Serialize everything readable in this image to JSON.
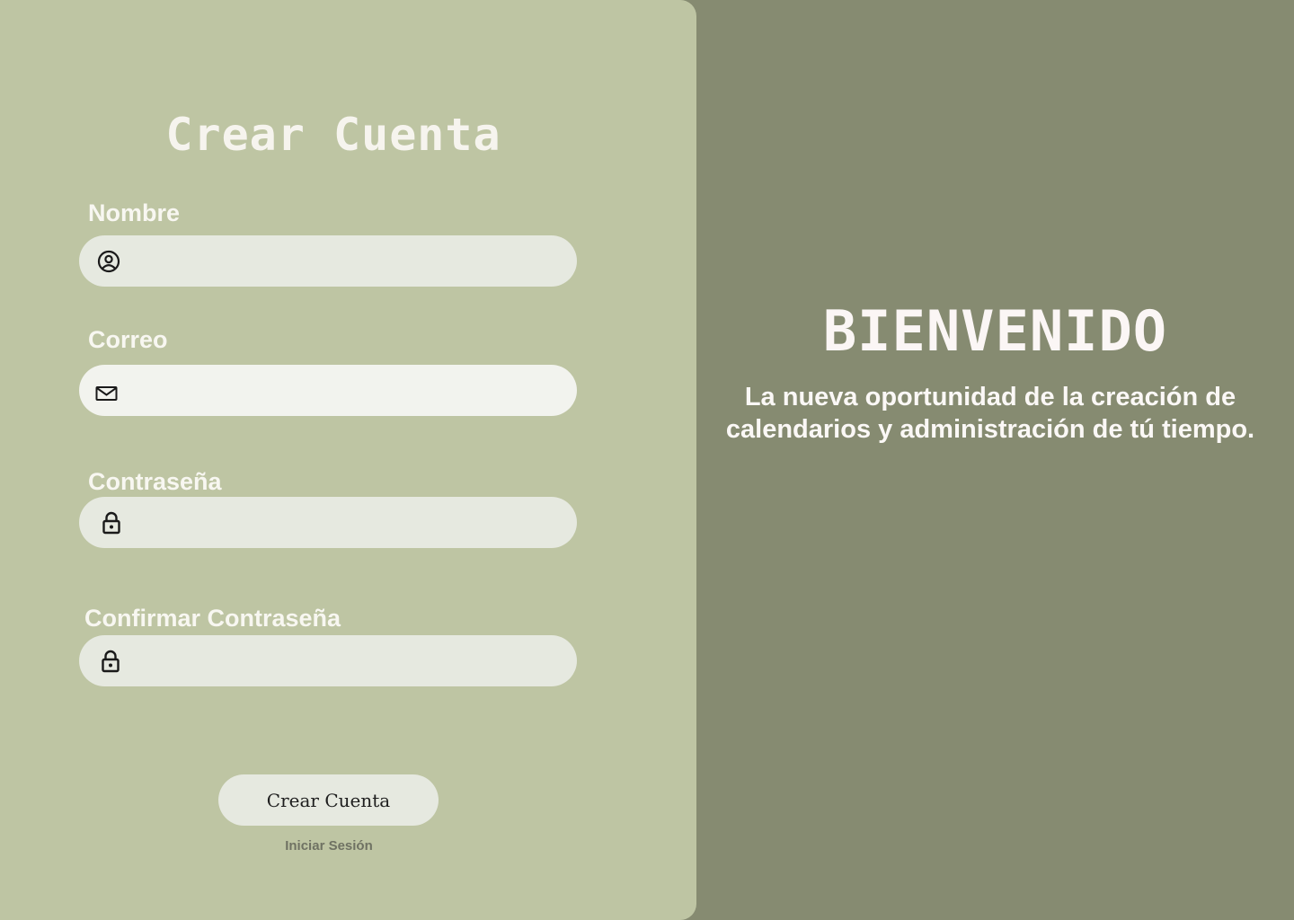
{
  "form": {
    "title": "Crear Cuenta",
    "fields": [
      {
        "label": "Nombre",
        "value": "",
        "placeholder": "",
        "icon": "user-circle-icon"
      },
      {
        "label": "Correo",
        "value": "",
        "placeholder": "",
        "icon": "mail-icon"
      },
      {
        "label": "Contraseña",
        "value": "",
        "placeholder": "",
        "icon": "lock-icon"
      },
      {
        "label": "Confirmar Contraseña",
        "value": "",
        "placeholder": "",
        "icon": "lock-icon"
      }
    ],
    "submit_label": "Crear Cuenta",
    "login_link": "Iniciar Sesión"
  },
  "welcome": {
    "title": "BIENVENIDO",
    "text": "La nueva oportunidad de la creación de calendarios y administración de tú tiempo."
  },
  "colors": {
    "left_panel": "#bec5a3",
    "right_panel": "#868b71",
    "field_background": "#e6e9e0",
    "title_text": "#f6f4ee"
  }
}
